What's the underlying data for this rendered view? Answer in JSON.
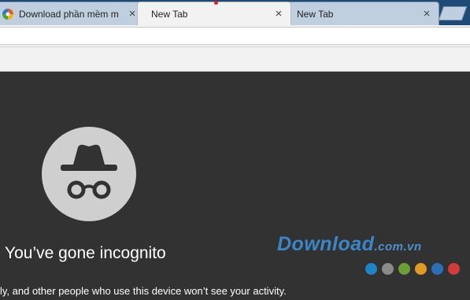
{
  "tabs": [
    {
      "title": "Download phần mềm m",
      "close": "×",
      "active": false,
      "favicon": "download-site-favicon"
    },
    {
      "title": "New Tab",
      "close": "×",
      "active": true,
      "media_indicator": "recording-dot"
    },
    {
      "title": "New Tab",
      "close": "×",
      "active": false
    }
  ],
  "newtab": {
    "icon": "new-tab-button"
  },
  "incognito": {
    "icon": "incognito-spy-icon",
    "heading": "You’ve gone incognito",
    "subtext": "ly, and other people who use this device won’t see your activity."
  },
  "watermark": {
    "brand": "Download",
    "suffix": ".com.vn",
    "dot_colors": [
      "#1d84c6",
      "#8a8a8a",
      "#6aa036",
      "#e19b22",
      "#2a6fb8",
      "#d23b3b"
    ]
  },
  "colors": {
    "tabstrip": "#1e4a78",
    "active_tab": "#f2f2f2",
    "inactive_tab": "#bfcfe0",
    "content_bg": "#323232",
    "icon_circle": "#cfcfcf"
  }
}
